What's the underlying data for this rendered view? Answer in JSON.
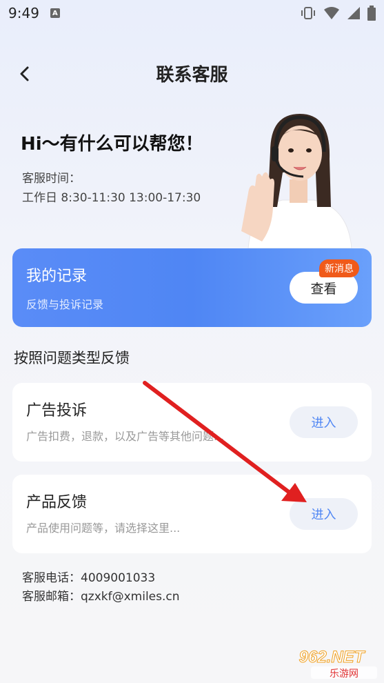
{
  "status_bar": {
    "time": "9:49"
  },
  "header": {
    "title": "联系客服"
  },
  "hero": {
    "greeting": "Hi～有什么可以帮您！",
    "hours_label": "客服时间：",
    "hours_value": "工作日 8:30-11:30 13:00-17:30"
  },
  "records": {
    "title": "我的记录",
    "subtitle": "反馈与投诉记录",
    "button_label": "查看",
    "badge": "新消息"
  },
  "section_title": "按照问题类型反馈",
  "cards": [
    {
      "title": "广告投诉",
      "subtitle": "广告扣费，退款，以及广告等其他问题...",
      "button_label": "进入"
    },
    {
      "title": "产品反馈",
      "subtitle": "产品使用问题等，请选择这里...",
      "button_label": "进入"
    }
  ],
  "contact": {
    "phone": "客服电话：4009001033",
    "email": "客服邮箱：qzxkf@xmiles.cn"
  },
  "watermark": {
    "top": "962.NET",
    "bottom": "乐游网"
  },
  "colors": {
    "accent": "#4f86f4",
    "badge": "#f05a1a",
    "arrow": "#e02020"
  }
}
